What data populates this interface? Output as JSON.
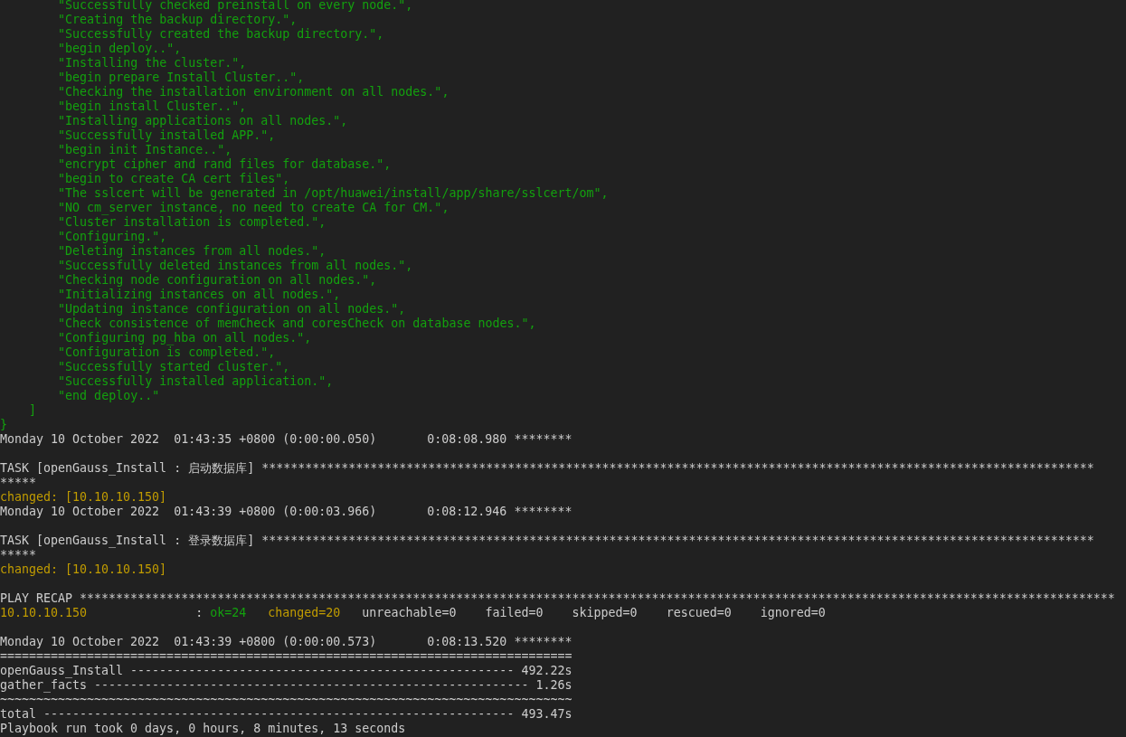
{
  "terminal": {
    "lines": [
      {
        "kind": "json",
        "text": "\"Successfully checked preinstall on every node.\","
      },
      {
        "kind": "json",
        "text": "\"Creating the backup directory.\","
      },
      {
        "kind": "json",
        "text": "\"Successfully created the backup directory.\","
      },
      {
        "kind": "json",
        "text": "\"begin deploy..\","
      },
      {
        "kind": "json",
        "text": "\"Installing the cluster.\","
      },
      {
        "kind": "json",
        "text": "\"begin prepare Install Cluster..\","
      },
      {
        "kind": "json",
        "text": "\"Checking the installation environment on all nodes.\","
      },
      {
        "kind": "json",
        "text": "\"begin install Cluster..\","
      },
      {
        "kind": "json",
        "text": "\"Installing applications on all nodes.\","
      },
      {
        "kind": "json",
        "text": "\"Successfully installed APP.\","
      },
      {
        "kind": "json",
        "text": "\"begin init Instance..\","
      },
      {
        "kind": "json",
        "text": "\"encrypt cipher and rand files for database.\","
      },
      {
        "kind": "json",
        "text": "\"begin to create CA cert files\","
      },
      {
        "kind": "json",
        "text": "\"The sslcert will be generated in /opt/huawei/install/app/share/sslcert/om\","
      },
      {
        "kind": "json",
        "text": "\"NO cm_server instance, no need to create CA for CM.\","
      },
      {
        "kind": "json",
        "text": "\"Cluster installation is completed.\","
      },
      {
        "kind": "json",
        "text": "\"Configuring.\","
      },
      {
        "kind": "json",
        "text": "\"Deleting instances from all nodes.\","
      },
      {
        "kind": "json",
        "text": "\"Successfully deleted instances from all nodes.\","
      },
      {
        "kind": "json",
        "text": "\"Checking node configuration on all nodes.\","
      },
      {
        "kind": "json",
        "text": "\"Initializing instances on all nodes.\","
      },
      {
        "kind": "json",
        "text": "\"Updating instance configuration on all nodes.\","
      },
      {
        "kind": "json",
        "text": "\"Check consistence of memCheck and coresCheck on database nodes.\","
      },
      {
        "kind": "json",
        "text": "\"Configuring pg_hba on all nodes.\","
      },
      {
        "kind": "json",
        "text": "\"Configuration is completed.\","
      },
      {
        "kind": "json",
        "text": "\"Successfully started cluster.\","
      },
      {
        "kind": "json",
        "text": "\"Successfully installed application.\","
      },
      {
        "kind": "json",
        "text": "\"end deploy..\""
      },
      {
        "kind": "bracket",
        "text": "]"
      },
      {
        "kind": "brace",
        "text": "}"
      },
      {
        "kind": "plain",
        "text": "Monday 10 October 2022  01:43:35 +0800 (0:00:00.050)       0:08:08.980 ********"
      },
      {
        "kind": "blank"
      },
      {
        "kind": "plain",
        "text": "TASK [openGauss_Install : 启动数据库] *******************************************************************************************************************"
      },
      {
        "kind": "plain",
        "text": "*****"
      },
      {
        "kind": "changed",
        "text": "changed: [10.10.10.150]"
      },
      {
        "kind": "plain",
        "text": "Monday 10 October 2022  01:43:39 +0800 (0:00:03.966)       0:08:12.946 ********"
      },
      {
        "kind": "blank"
      },
      {
        "kind": "plain",
        "text": "TASK [openGauss_Install : 登录数据库] *******************************************************************************************************************"
      },
      {
        "kind": "plain",
        "text": "*****"
      },
      {
        "kind": "changed",
        "text": "changed: [10.10.10.150]"
      },
      {
        "kind": "blank"
      },
      {
        "kind": "plain",
        "text": "PLAY RECAP ***********************************************************************************************************************************************"
      },
      {
        "kind": "recap",
        "fields": [
          {
            "kind": "host",
            "text": "10.10.10.150"
          },
          {
            "kind": "plain",
            "text": ":"
          },
          {
            "kind": "ok",
            "text": "ok=24"
          },
          {
            "kind": "changed",
            "text": "changed=20"
          },
          {
            "kind": "plain",
            "text": "unreachable=0"
          },
          {
            "kind": "plain",
            "text": "failed=0"
          },
          {
            "kind": "plain",
            "text": "skipped=0"
          },
          {
            "kind": "plain",
            "text": "rescued=0"
          },
          {
            "kind": "plain",
            "text": "ignored=0"
          }
        ]
      },
      {
        "kind": "blank"
      },
      {
        "kind": "plain",
        "text": "Monday 10 October 2022  01:43:39 +0800 (0:00:00.573)       0:08:13.520 ********"
      },
      {
        "kind": "plain",
        "text": "==============================================================================="
      },
      {
        "kind": "plain",
        "text": "openGauss_Install ----------------------------------------------------- 492.22s"
      },
      {
        "kind": "plain",
        "text": "gather_facts ------------------------------------------------------------ 1.26s"
      },
      {
        "kind": "plain",
        "text": "~~~~~~~~~~~~~~~~~~~~~~~~~~~~~~~~~~~~~~~~~~~~~~~~~~~~~~~~~~~~~~~~~~~~~~~~~~~~~~~"
      },
      {
        "kind": "plain",
        "text": "total ----------------------------------------------------------------- 493.47s"
      },
      {
        "kind": "plain",
        "text": "Playbook run took 0 days, 0 hours, 8 minutes, 13 seconds"
      }
    ]
  }
}
